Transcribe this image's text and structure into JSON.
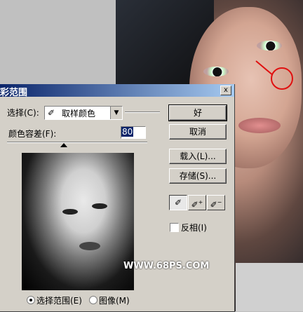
{
  "dialog": {
    "title": "彩范围",
    "close_label": "x",
    "select_label": "选择(C):",
    "select_value": "取样颜色",
    "fuzziness_label": "颜色容差(F):",
    "fuzziness_value": "80",
    "watermark": "WWW.68PS.COM",
    "buttons": {
      "ok": "好",
      "cancel": "取消",
      "load": "载入(L)...",
      "save": "存储(S)..."
    },
    "eyedroppers": [
      "eyedropper-icon",
      "eyedropper-plus-icon",
      "eyedropper-minus-icon"
    ],
    "invert_label": "反相(I)",
    "radio": {
      "selection_label": "选择范围(E)",
      "image_label": "图像(M)",
      "selected": "selection"
    }
  },
  "colors": {
    "title_start": "#0a246a",
    "title_end": "#a6caf0",
    "dialog_bg": "#d4d0c8",
    "annotation": "#e01010"
  }
}
